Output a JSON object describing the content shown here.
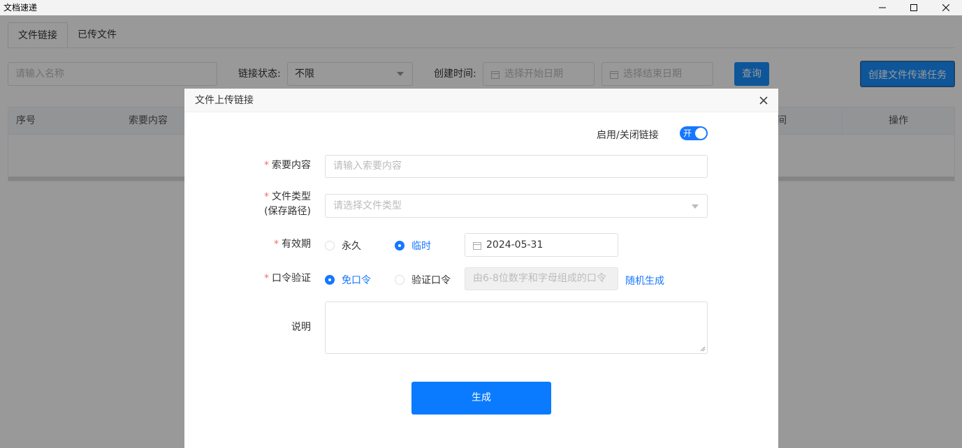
{
  "window": {
    "title": "文档速递"
  },
  "tabs": [
    "文件链接",
    "已传文件"
  ],
  "filters": {
    "name_placeholder": "请输入名称",
    "status_label": "链接状态:",
    "status_value": "不限",
    "time_label": "创建时间:",
    "start_placeholder": "选择开始日期",
    "end_placeholder": "选择结束日期",
    "query_button": "查询",
    "create_button": "创建文件传递任务"
  },
  "table": {
    "columns": {
      "index": "序号",
      "content": "索要内容",
      "time": "间",
      "actions": "操作"
    }
  },
  "modal": {
    "title": "文件上传链接",
    "toggle_label": "启用/关闭链接",
    "toggle_text": "开",
    "content_label": "索要内容",
    "content_placeholder": "请输入索要内容",
    "type_label": "文件类型",
    "type_label2": "(保存路径)",
    "type_placeholder": "请选择文件类型",
    "validity_label": "有效期",
    "validity_options": [
      "永久",
      "临时"
    ],
    "validity_date": "2024-05-31",
    "password_label": "口令验证",
    "password_options": [
      "免口令",
      "验证口令"
    ],
    "password_placeholder": "由6-8位数字和字母组成的口令",
    "random_link": "随机生成",
    "desc_label": "说明",
    "generate_button": "生成"
  },
  "colors": {
    "primary": "#1677ff",
    "required": "#f56c6c"
  }
}
